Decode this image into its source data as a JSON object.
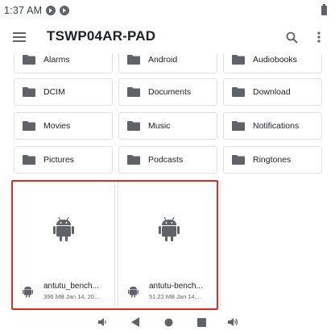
{
  "status_bar": {
    "time": "1:37 AM",
    "notification_icons": [
      "app-notification-icon",
      "app-notification-icon"
    ],
    "battery_icon": "battery-icon"
  },
  "app_bar": {
    "menu_icon": "menu-icon",
    "title": "TSWP04AR-PAD",
    "search_icon": "search-icon",
    "more_icon": "more-vert-icon"
  },
  "folders": [
    {
      "label": "Alarms",
      "icon": "folder-icon"
    },
    {
      "label": "Android",
      "icon": "folder-icon"
    },
    {
      "label": "Audiobooks",
      "icon": "folder-icon"
    },
    {
      "label": "DCIM",
      "icon": "folder-icon"
    },
    {
      "label": "Documents",
      "icon": "folder-icon"
    },
    {
      "label": "Download",
      "icon": "folder-icon"
    },
    {
      "label": "Movies",
      "icon": "folder-icon"
    },
    {
      "label": "Music",
      "icon": "folder-icon"
    },
    {
      "label": "Notifications",
      "icon": "folder-icon"
    },
    {
      "label": "Pictures",
      "icon": "folder-icon"
    },
    {
      "label": "Podcasts",
      "icon": "folder-icon"
    },
    {
      "label": "Ringtones",
      "icon": "folder-icon"
    }
  ],
  "files": [
    {
      "name": "antutu_bench...",
      "details": "396 MB Jan 14, 20...",
      "icon": "android-icon"
    },
    {
      "name": "antutu-bench...",
      "details": "51.22 MB Jan 14,...",
      "icon": "android-icon"
    }
  ],
  "nav_bar": {
    "buttons": [
      "volume-down-icon",
      "back-icon",
      "home-icon",
      "recents-icon",
      "volume-up-icon"
    ]
  },
  "colors": {
    "selection": "#d93025",
    "icon_gray": "#5f6368",
    "tile_border": "#e3e3e3"
  }
}
